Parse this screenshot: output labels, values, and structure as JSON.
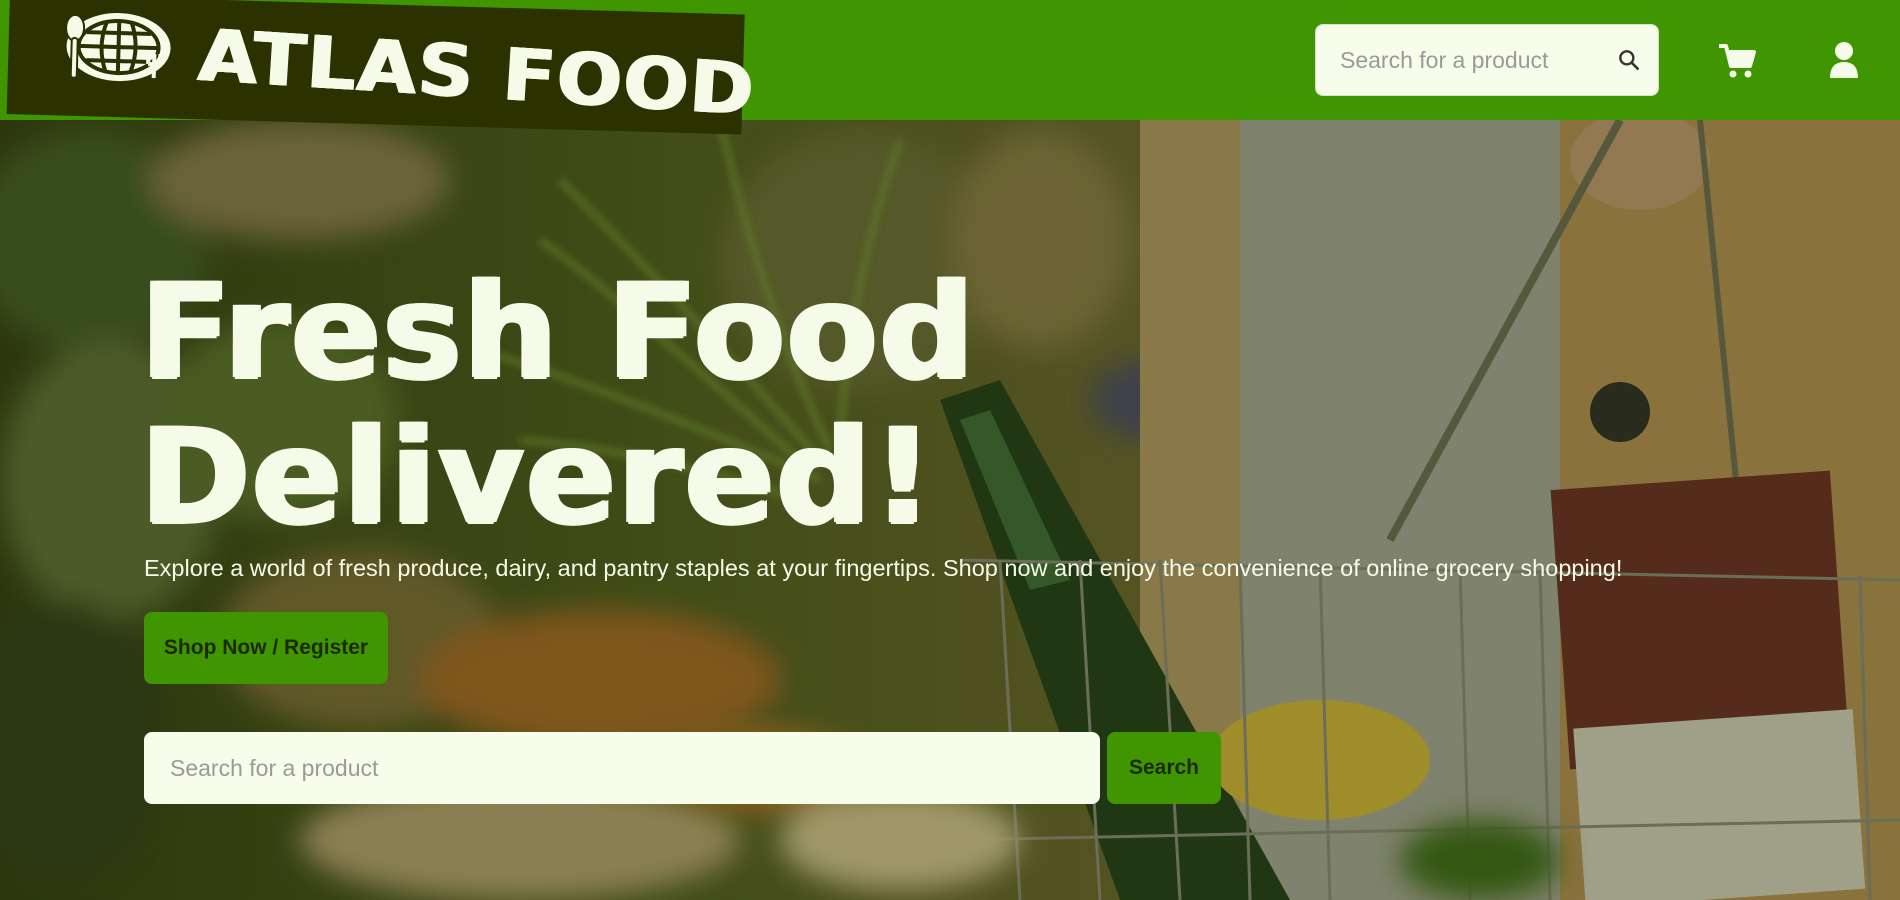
{
  "brand": {
    "name": "ATLAS FOOD",
    "colors": {
      "primary": "#3f9600",
      "dark": "#2b3200",
      "cream": "#f6fbe9",
      "button_text": "#1d2a00"
    }
  },
  "header": {
    "search": {
      "placeholder": "Search for a product",
      "value": "",
      "icon": "search-icon"
    },
    "cart_icon": "cart-icon",
    "account_icon": "user-icon"
  },
  "hero": {
    "title_line1": "Fresh Food",
    "title_line2": "Delivered!",
    "description": "Explore a world of fresh produce, dairy, and pantry staples at your fingertips. Shop now and enjoy the convenience of online grocery shopping!",
    "cta_label": "Shop Now / Register",
    "search": {
      "placeholder": "Search for a product",
      "value": "",
      "button_label": "Search"
    },
    "background": "grocery-basket-photo"
  }
}
